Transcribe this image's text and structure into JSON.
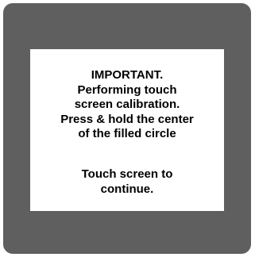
{
  "calibration_dialog": {
    "message_lines": [
      "IMPORTANT.",
      "Performing touch",
      "screen calibration.",
      "Press & hold the center",
      "of the filled circle"
    ],
    "continue_lines": [
      "Touch screen to",
      "continue."
    ]
  },
  "colors": {
    "frame": "#5f5f5f",
    "panel": "#ffffff",
    "text": "#000000"
  }
}
